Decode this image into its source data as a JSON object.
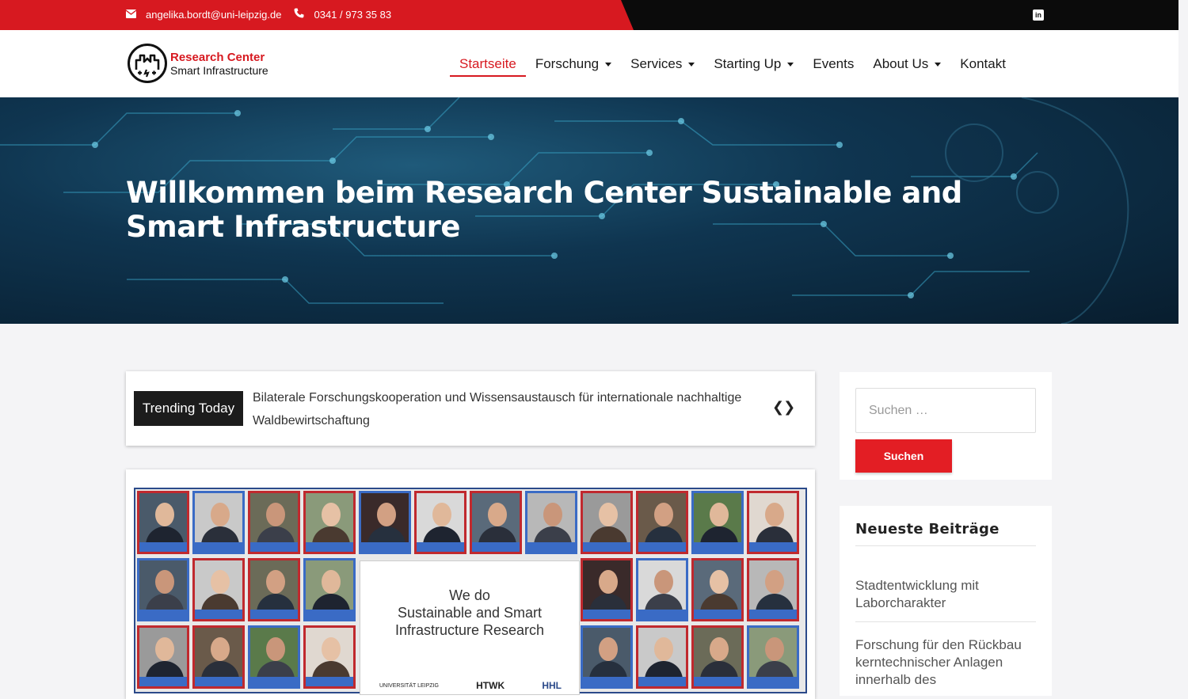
{
  "topbar": {
    "email": "angelika.bordt@uni-leipzig.de",
    "phone": "0341 / 973 35 83",
    "social_icon": "linkedin-icon"
  },
  "logo": {
    "line1": "Research Center",
    "line2": "Smart Infrastructure"
  },
  "nav": {
    "items": [
      {
        "label": "Startseite",
        "active": true
      },
      {
        "label": "Forschung",
        "dropdown": true
      },
      {
        "label": "Services",
        "dropdown": true
      },
      {
        "label": "Starting Up",
        "dropdown": true
      },
      {
        "label": "Events"
      },
      {
        "label": "About Us",
        "dropdown": true
      },
      {
        "label": "Kontakt"
      }
    ]
  },
  "hero": {
    "title": "Willkommen beim Research Center Sustainable and Smart Infrastructure"
  },
  "trending": {
    "label": "Trending Today",
    "text": "Bilaterale Forschungskooperation und Wissensaustausch für internationale nachhaltige Waldbewirtschaftung",
    "arrows": "❮❯"
  },
  "feature": {
    "center_text": [
      "We do",
      "Sustainable and Smart",
      "Infrastructure Research"
    ],
    "logos": [
      "UNIVERSITÄT LEIPZIG",
      "HTWK",
      "HHL"
    ]
  },
  "sidebar": {
    "search_placeholder": "Suchen …",
    "search_button": "Suchen",
    "recent_title": "Neueste Beiträge",
    "recent_posts": [
      "Stadtentwicklung mit Laborcharakter",
      "Forschung für den Rückbau kerntechnischer Anlagen innerhalb des"
    ]
  },
  "colors": {
    "accent": "#d71920",
    "topbar_dark": "#0b0b0b",
    "button": "#e31e24"
  }
}
